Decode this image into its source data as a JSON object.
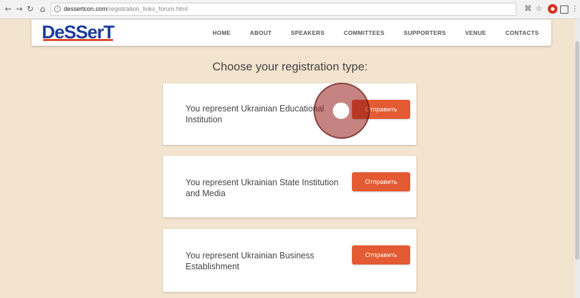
{
  "browser": {
    "url_host": "dessertcon.com",
    "url_path": "/registration_links_forum.html",
    "info_icon": "i"
  },
  "site": {
    "logo_text": "DeSSerT",
    "menu": [
      "HOME",
      "ABOUT",
      "SPEAKERS",
      "COMMITTEES",
      "SUPPORTERS",
      "VENUE",
      "CONTACTS"
    ]
  },
  "page_title": "Choose your registration type:",
  "cards": [
    {
      "text": "You represent Ukrainian Educational Institution",
      "button": "Отправить"
    },
    {
      "text": "You represent Ukrainian State Institution and Media",
      "button": "Отправить"
    },
    {
      "text": "You represent Ukrainian Business Establishment",
      "button": "Отправить"
    }
  ],
  "colors": {
    "accent": "#e35a33",
    "logo_blue": "#1c3c9c",
    "background": "#f3e4cf"
  }
}
